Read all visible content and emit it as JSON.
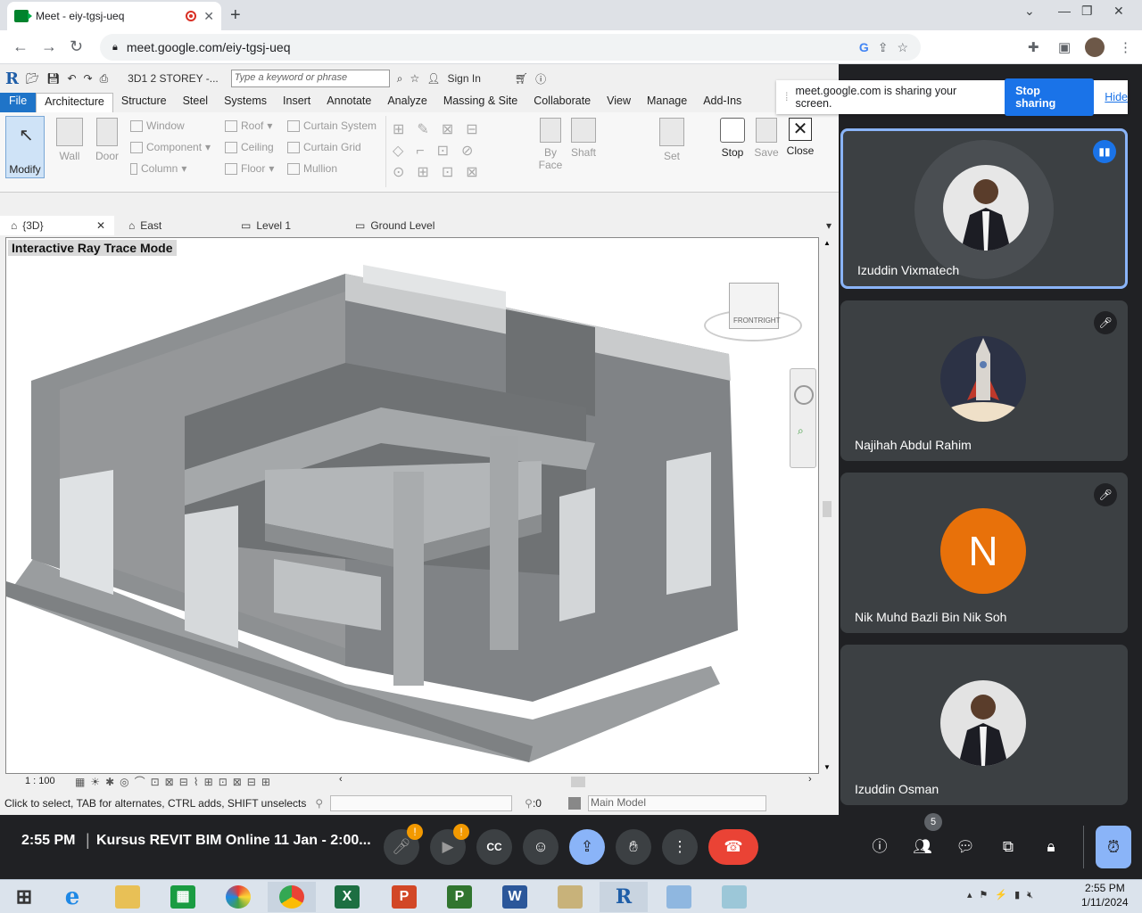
{
  "browser": {
    "tab_title": "Meet - eiy-tgsj-ueq",
    "url": "meet.google.com/eiy-tgsj-ueq"
  },
  "revit": {
    "doc_title": "3D1 2 STOREY -...",
    "search_placeholder": "Type a keyword or phrase",
    "sign_in": "Sign In",
    "tabs": [
      "File",
      "Architecture",
      "Structure",
      "Steel",
      "Systems",
      "Insert",
      "Annotate",
      "Analyze",
      "Massing & Site",
      "Collaborate",
      "View",
      "Manage",
      "Add-Ins"
    ],
    "ribbon": {
      "modify": "Modify",
      "wall": "Wall",
      "door": "Door",
      "window": "Window",
      "component": "Component",
      "column": "Column",
      "roof": "Roof",
      "ceiling": "Ceiling",
      "floor": "Floor",
      "curtain_system": "Curtain System",
      "curtain_grid": "Curtain Grid",
      "mullion": "Mullion",
      "by_face": "By Face",
      "shaft": "Shaft",
      "set": "Set",
      "stop": "Stop",
      "save": "Save",
      "close": "Close"
    },
    "view_tabs": [
      "{3D}",
      "East",
      "Level 1",
      "Ground Level"
    ],
    "viewport_label": "Interactive Ray Trace Mode",
    "viewcube": {
      "front": "FRONT",
      "right": "RIGHT"
    },
    "scale": "1 : 100",
    "status_text": "Click to select, TAB for alternates, CTRL adds, SHIFT unselects",
    "status_count": ":0",
    "model": "Main Model"
  },
  "share_notice": {
    "text": "meet.google.com is sharing your screen.",
    "stop": "Stop sharing",
    "hide": "Hide"
  },
  "participants": [
    {
      "name": "Izuddin Vixmatech"
    },
    {
      "name": "Najihah Abdul Rahim"
    },
    {
      "name": "Nik Muhd Bazli Bin Nik Soh",
      "initial": "N"
    },
    {
      "name": "Izuddin Osman"
    }
  ],
  "meeting": {
    "time": "2:55 PM",
    "title": "Kursus REVIT BIM Online 11 Jan - 2:00...",
    "people_count": "5"
  },
  "taskbar": {
    "time": "2:55 PM",
    "date": "1/11/2024"
  }
}
